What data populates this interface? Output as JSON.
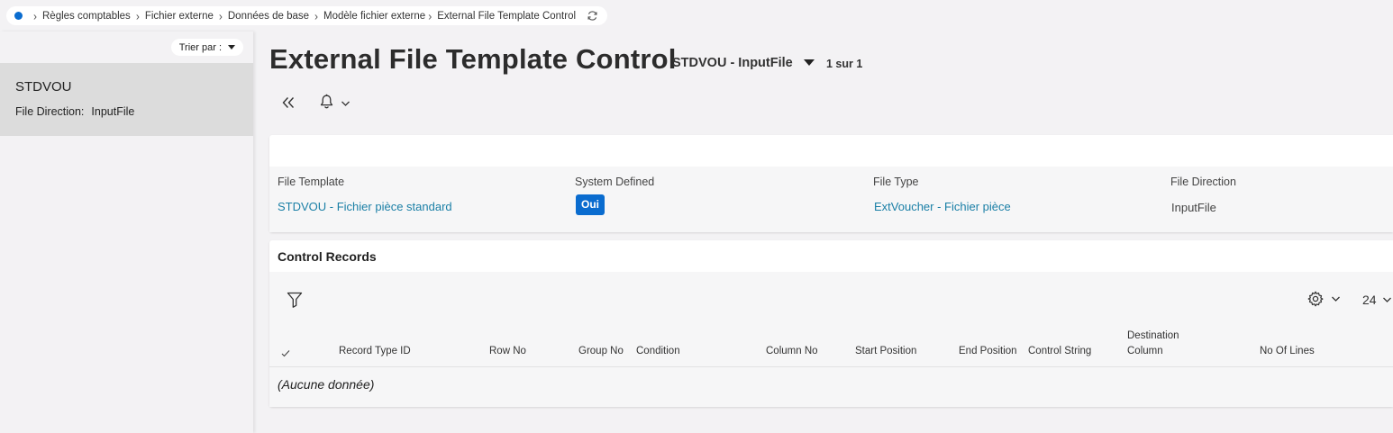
{
  "breadcrumb": {
    "items": [
      "Règles comptables",
      "Fichier externe",
      "Données de base",
      "Modèle fichier externe",
      "External File Template Control"
    ]
  },
  "left_panel": {
    "sort_label": "Trier par :",
    "item": {
      "title": "STDVOU",
      "sub_label": "File Direction:",
      "sub_value": "InputFile"
    }
  },
  "header": {
    "title": "External File Template Control",
    "record": "STDVOU - InputFile",
    "pager": "1 sur 1"
  },
  "details": {
    "file_template_label": "File Template",
    "file_template_value": "STDVOU - Fichier pièce standard",
    "system_defined_label": "System Defined",
    "system_defined_value": "Oui",
    "file_type_label": "File Type",
    "file_type_value": "ExtVoucher - Fichier pièce",
    "file_direction_label": "File Direction",
    "file_direction_value": "InputFile"
  },
  "control_records": {
    "title": "Control Records",
    "page_size": "24",
    "columns": [
      "Record Type ID",
      "Row No",
      "Group No",
      "Condition",
      "Column No",
      "Start Position",
      "End Position",
      "Control String",
      "Destination\nColumn",
      "No Of Lines"
    ],
    "empty_text": "(Aucune donnée)"
  },
  "colors": {
    "accent": "#0a6ccf",
    "link": "#1a7fa6",
    "selected_item_bg": "#dcdcdc",
    "page_bg": "#f3f2f4"
  }
}
